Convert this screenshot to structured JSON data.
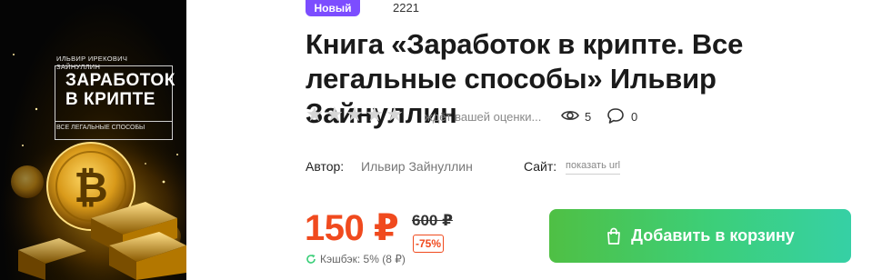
{
  "cover": {
    "author": "ИЛЬВИР ИРЕКОВИЧ ЗАЙНУЛЛИН",
    "title_line1": "ЗАРАБОТОК",
    "title_line2": "В КРИПТЕ",
    "subtitle": "ВСЕ ЛЕГАЛЬНЫЕ СПОСОБЫ",
    "coin_symbol": "₿"
  },
  "badge": "Новый",
  "product_id": "2221",
  "title": "Книга «Заработок в крипте. Все легальные способы» Ильвир Зайнуллин",
  "rating": {
    "stars": [
      "★",
      "★",
      "★",
      "★",
      "★"
    ],
    "value": 0,
    "max": 5,
    "text": "ждёт вашей оценки...",
    "views": "5",
    "comments": "0"
  },
  "author": {
    "label": "Автор:",
    "value": "Ильвир Зайнуллин"
  },
  "site": {
    "label": "Сайт:",
    "link": "показать url"
  },
  "price": {
    "current": "150 ₽",
    "old": "600 ₽",
    "discount": "-75%",
    "cashback": "Кэшбэк: 5% (8 ₽)"
  },
  "cart_button": "Добавить в корзину",
  "colors": {
    "badge": "#7c4dff",
    "price": "#f04a1e",
    "button_start": "#4fc044",
    "button_end": "#36d0a5"
  }
}
